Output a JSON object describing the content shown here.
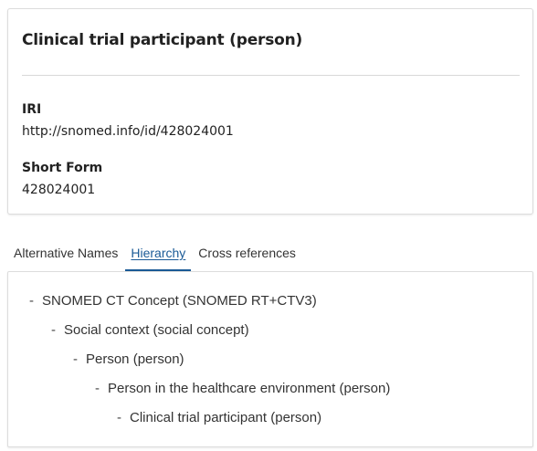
{
  "entity": {
    "title": "Clinical trial participant (person)",
    "iri_label": "IRI",
    "iri_value": "http://snomed.info/id/428024001",
    "short_form_label": "Short Form",
    "short_form_value": "428024001"
  },
  "tabs": [
    {
      "label": "Alternative Names",
      "active": false
    },
    {
      "label": "Hierarchy",
      "active": true
    },
    {
      "label": "Cross references",
      "active": false
    }
  ],
  "hierarchy": {
    "dash": "-",
    "items": [
      {
        "label": "SNOMED CT Concept (SNOMED RT+CTV3)",
        "level": 0
      },
      {
        "label": "Social context (social concept)",
        "level": 1
      },
      {
        "label": "Person (person)",
        "level": 2
      },
      {
        "label": "Person in the healthcare environment (person)",
        "level": 3
      },
      {
        "label": "Clinical trial participant (person)",
        "level": 4
      }
    ]
  },
  "colors": {
    "active_tab": "#1a5a96",
    "text": "#222222",
    "border": "#dcdcdc"
  }
}
